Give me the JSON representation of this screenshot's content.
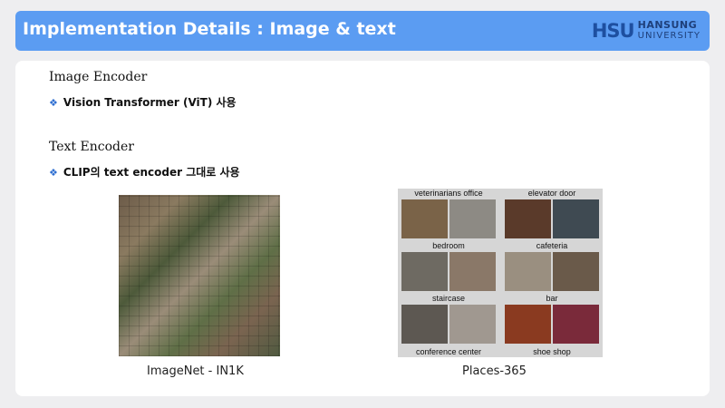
{
  "header": {
    "title": "Implementation Details : Image & text",
    "logo": {
      "mark": "HSU",
      "name_top": "HANSUNG",
      "name_bottom": "UNIVERSITY"
    }
  },
  "sections": [
    {
      "heading": "Image Encoder",
      "bullet": "Vision Transformer (ViT) 사용"
    },
    {
      "heading": "Text Encoder",
      "bullet": "CLIP의 text encoder 그대로 사용"
    }
  ],
  "figures": {
    "imagenet_caption": "ImageNet - IN1K",
    "places_caption": "Places-365",
    "places_labels": [
      "veterinarians office",
      "elevator door",
      "bedroom",
      "cafeteria",
      "staircase",
      "bar",
      "conference center",
      "shoe shop"
    ]
  },
  "colors": {
    "title_bar": "#5b9cf2",
    "bullet_mark": "#2f6fd1"
  }
}
